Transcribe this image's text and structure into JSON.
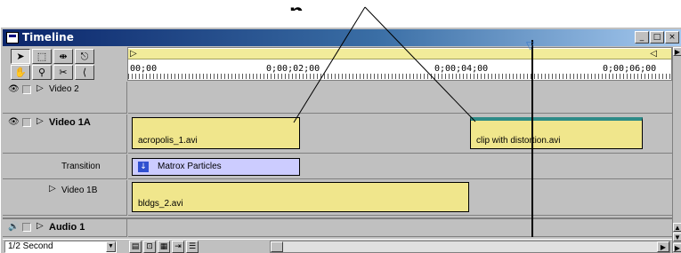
{
  "caption": {
    "partial_text": "p"
  },
  "window": {
    "title": "Timeline",
    "controls": {
      "minimize": "_",
      "maximize": "□",
      "close": "×"
    }
  },
  "tools": [
    {
      "name": "selection-tool-icon",
      "glyph": "➤"
    },
    {
      "name": "range-select-tool-icon",
      "glyph": "⬚"
    },
    {
      "name": "track-select-tool-icon",
      "glyph": "⇼"
    },
    {
      "name": "link-tool-icon",
      "glyph": "⎋"
    },
    {
      "name": "hand-tool-icon",
      "glyph": "✋"
    },
    {
      "name": "zoom-tool-icon",
      "glyph": "⚲"
    },
    {
      "name": "razor-tool-icon",
      "glyph": "✂"
    },
    {
      "name": "in-out-tool-icon",
      "glyph": "⟨"
    }
  ],
  "ruler": {
    "timecodes": [
      "00;00",
      "0;00;02;00",
      "0;00;04;00",
      "0;00;06;00"
    ],
    "work_area": {
      "left_marker": "▷",
      "right_marker": "◁"
    }
  },
  "tracks": {
    "video2": {
      "name": "Video 2"
    },
    "video1a": {
      "name": "Video 1A"
    },
    "transition": {
      "name": "Transition"
    },
    "video1b": {
      "name": "Video 1B"
    },
    "audio1": {
      "name": "Audio 1"
    }
  },
  "clips": {
    "acropolis": "acropolis_1.avi",
    "distortion": "clip with distortion.avi",
    "transition": "Matrox Particles",
    "bldgs": "bldgs_2.avi"
  },
  "bottom": {
    "zoom_value": "1/2 Second",
    "buttons": [
      "▤",
      "⊡",
      "▦",
      "⇥",
      "☰"
    ]
  },
  "colors": {
    "clip_fill": "#f0e68c",
    "transition_fill": "#ccccff",
    "distortion_accent": "#2e8b87",
    "title_start": "#0a246a",
    "title_end": "#a6caf0"
  }
}
